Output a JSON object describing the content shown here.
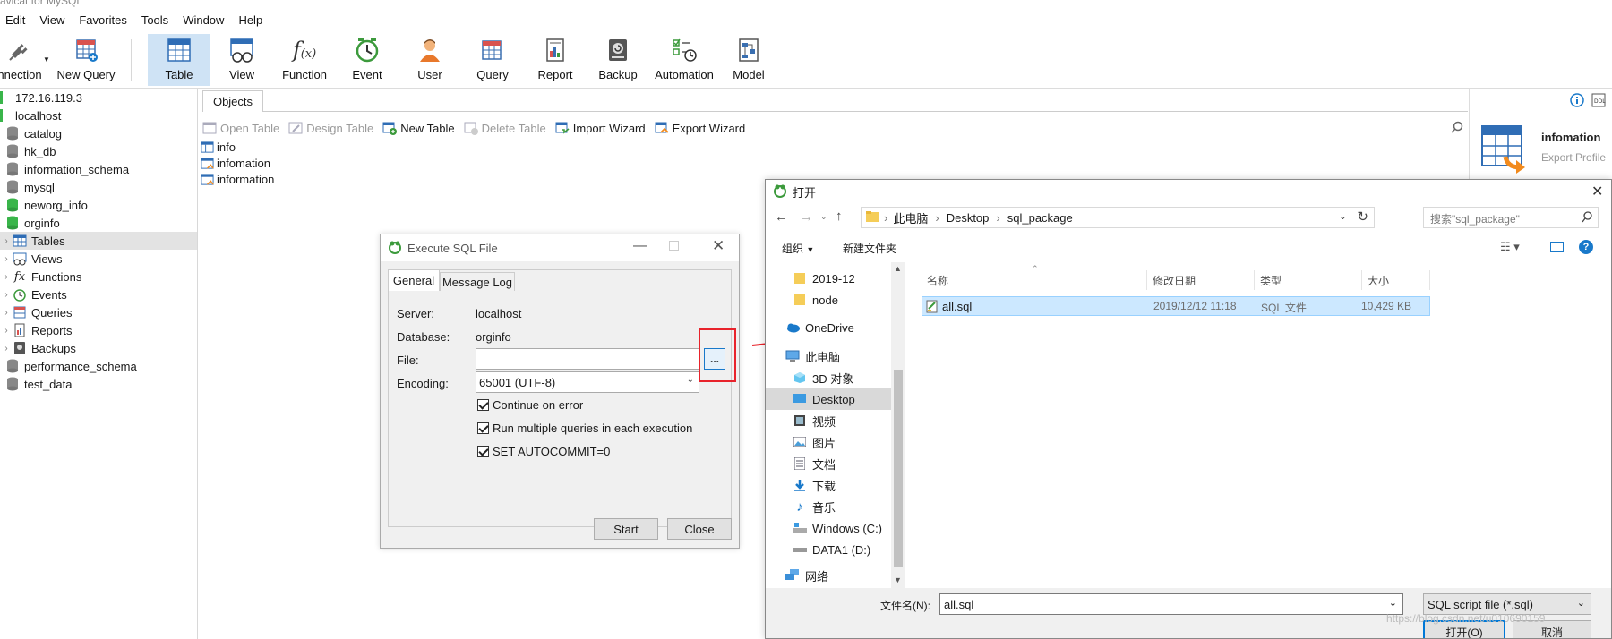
{
  "app": {
    "title": "avicat for MySQL"
  },
  "menu": [
    "Edit",
    "View",
    "Favorites",
    "Tools",
    "Window",
    "Help"
  ],
  "toolbar": {
    "connection": "nnection",
    "new_query": "New Query",
    "table": "Table",
    "view": "View",
    "function": "Function",
    "event": "Event",
    "user": "User",
    "query": "Query",
    "report": "Report",
    "backup": "Backup",
    "automation": "Automation",
    "model": "Model"
  },
  "tree": {
    "nodes": [
      "172.16.119.3",
      "localhost",
      "catalog",
      "hk_db",
      "information_schema",
      "mysql",
      "neworg_info",
      "orginfo",
      "Tables",
      "Views",
      "Functions",
      "Events",
      "Queries",
      "Reports",
      "Backups",
      "performance_schema",
      "test_data"
    ]
  },
  "objects": {
    "tab": "Objects",
    "actions": [
      "Open Table",
      "Design Table",
      "New Table",
      "Delete Table",
      "Import Wizard",
      "Export Wizard"
    ],
    "items": [
      "info",
      "infomation",
      "information"
    ]
  },
  "info_panel": {
    "name": "infomation",
    "subtitle": "Export Profile"
  },
  "exec_dialog": {
    "title": "Execute SQL File",
    "tabs": [
      "General",
      "Message Log"
    ],
    "server_label": "Server:",
    "server_value": "localhost",
    "database_label": "Database:",
    "database_value": "orginfo",
    "file_label": "File:",
    "file_value": "",
    "browse": "...",
    "encoding_label": "Encoding:",
    "encoding_value": "65001 (UTF-8)",
    "options": [
      "Continue on error",
      "Run multiple queries in each execution",
      "SET AUTOCOMMIT=0"
    ],
    "start": "Start",
    "close": "Close"
  },
  "open_dialog": {
    "title": "打开",
    "breadcrumb": [
      "此电脑",
      "Desktop",
      "sql_package"
    ],
    "search_placeholder": "搜索\"sql_package\"",
    "organize": "组织",
    "new_folder": "新建文件夹",
    "nav": [
      "2019-12",
      "node",
      "OneDrive",
      "此电脑",
      "3D 对象",
      "Desktop",
      "视频",
      "图片",
      "文档",
      "下载",
      "音乐",
      "Windows (C:)",
      "DATA1 (D:)",
      "网络"
    ],
    "columns": [
      "名称",
      "修改日期",
      "类型",
      "大小"
    ],
    "files": [
      {
        "name": "all.sql",
        "date": "2019/12/12 11:18",
        "type": "SQL 文件",
        "size": "10,429 KB"
      }
    ],
    "filename_label": "文件名(N):",
    "filename_value": "all.sql",
    "filter": "SQL script file (*.sql)",
    "open": "打开(O)",
    "cancel": "取消"
  },
  "watermark": "https://blog.csdn.net/u010690159",
  "colors": {
    "accent": "#1979ca",
    "highlight_red": "#e8232b",
    "selection": "#cce8ff"
  }
}
